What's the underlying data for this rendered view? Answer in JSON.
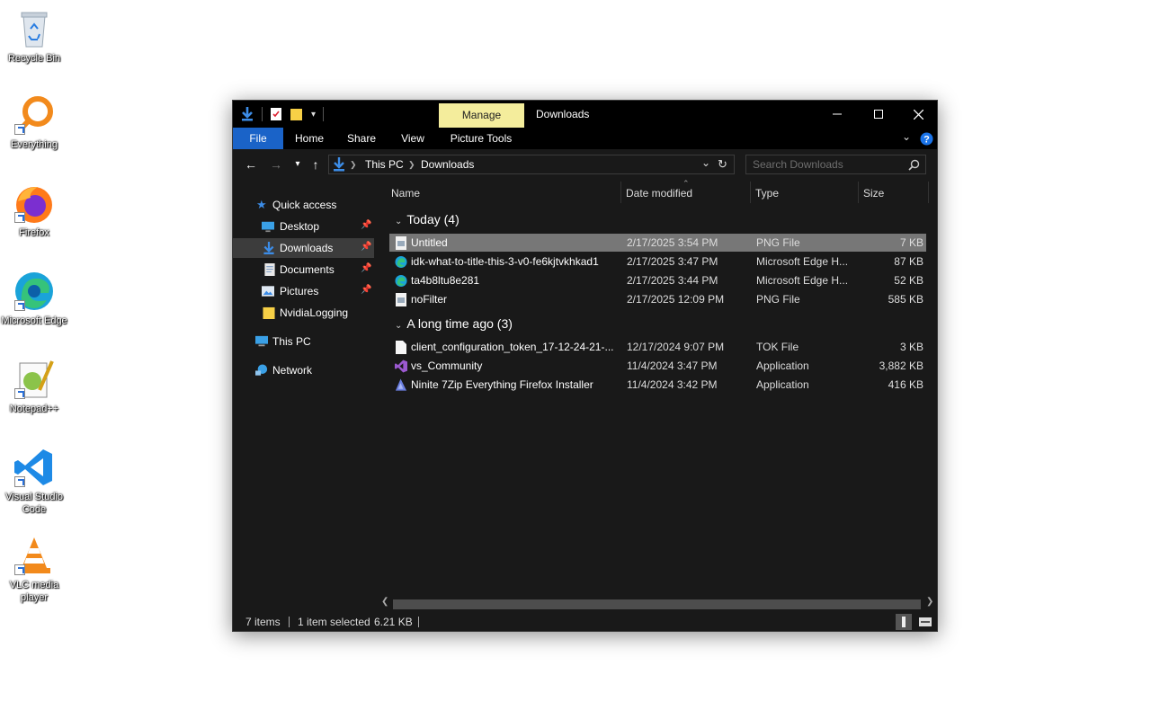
{
  "desktop": {
    "icons": [
      {
        "label": "Recycle Bin",
        "icon": "recycle-bin-icon"
      },
      {
        "label": "Everything",
        "icon": "everything-search-icon"
      },
      {
        "label": "Firefox",
        "icon": "firefox-icon"
      },
      {
        "label": "Microsoft Edge",
        "icon": "edge-icon"
      },
      {
        "label": "Notepad++",
        "icon": "notepadpp-icon"
      },
      {
        "label": "Visual Studio Code",
        "icon": "vscode-icon"
      },
      {
        "label": "VLC media player",
        "icon": "vlc-icon"
      }
    ]
  },
  "window": {
    "title": "Downloads",
    "context_tab": "Manage",
    "ribbon_tabs": [
      "File",
      "Home",
      "Share",
      "View",
      "Picture Tools"
    ],
    "address": {
      "crumbs": [
        "This PC",
        "Downloads"
      ]
    },
    "search": {
      "placeholder": "Search Downloads"
    },
    "nav_pane": {
      "quick_access": "Quick access",
      "items": [
        {
          "label": "Desktop",
          "pinned": true
        },
        {
          "label": "Downloads",
          "pinned": true,
          "selected": true
        },
        {
          "label": "Documents",
          "pinned": true
        },
        {
          "label": "Pictures",
          "pinned": true
        },
        {
          "label": "NvidiaLogging",
          "pinned": false
        }
      ],
      "this_pc": "This PC",
      "network": "Network"
    },
    "columns": {
      "name": "Name",
      "date": "Date modified",
      "type": "Type",
      "size": "Size"
    },
    "groups": [
      {
        "label": "Today (4)",
        "files": [
          {
            "name": "Untitled",
            "date": "2/17/2025 3:54 PM",
            "type": "PNG File",
            "size": "7 KB",
            "icon": "png-file-icon",
            "selected": true
          },
          {
            "name": "idk-what-to-title-this-3-v0-fe6kjtvkhkad1",
            "date": "2/17/2025 3:47 PM",
            "type": "Microsoft Edge H...",
            "size": "87 KB",
            "icon": "edge-html-icon"
          },
          {
            "name": "ta4b8ltu8e281",
            "date": "2/17/2025 3:44 PM",
            "type": "Microsoft Edge H...",
            "size": "52 KB",
            "icon": "edge-html-icon"
          },
          {
            "name": "noFilter",
            "date": "2/17/2025 12:09 PM",
            "type": "PNG File",
            "size": "585 KB",
            "icon": "png-file-icon"
          }
        ]
      },
      {
        "label": "A long time ago (3)",
        "files": [
          {
            "name": "client_configuration_token_17-12-24-21-...",
            "date": "12/17/2024 9:07 PM",
            "type": "TOK File",
            "size": "3 KB",
            "icon": "blank-file-icon"
          },
          {
            "name": "vs_Community",
            "date": "11/4/2024 3:47 PM",
            "type": "Application",
            "size": "3,882 KB",
            "icon": "visual-studio-icon"
          },
          {
            "name": "Ninite 7Zip Everything Firefox Installer",
            "date": "11/4/2024 3:42 PM",
            "type": "Application",
            "size": "416 KB",
            "icon": "ninite-icon"
          }
        ]
      }
    ],
    "status": {
      "items": "7 items",
      "selected": "1 item selected",
      "size": "6.21 KB"
    }
  }
}
